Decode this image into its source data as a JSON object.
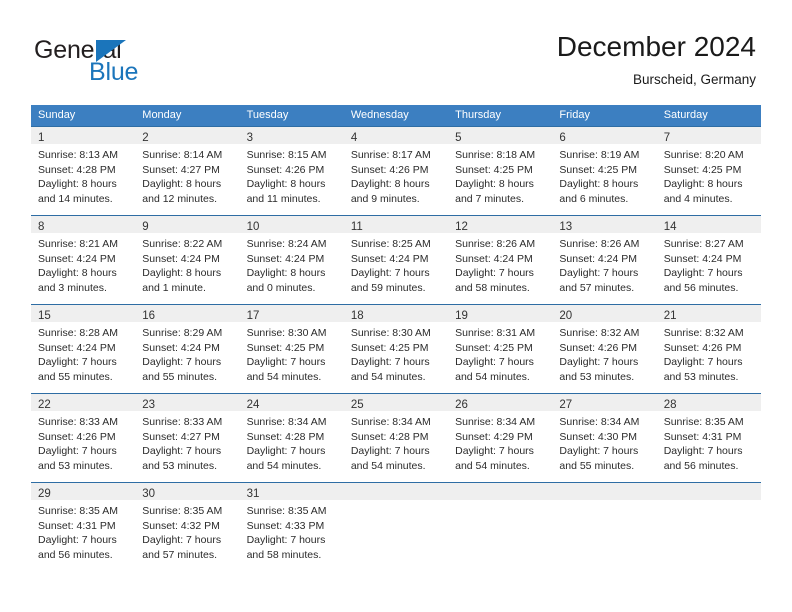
{
  "brand": {
    "logo_top": "General",
    "logo_bottom": "Blue",
    "accent_color": "#1b75bb"
  },
  "header": {
    "title": "December 2024",
    "subtitle": "Burscheid, Germany"
  },
  "theme": {
    "header_row_bg": "#3c7fc1",
    "row_divider": "#2e6da4",
    "daynum_band_bg": "#efefef"
  },
  "weekday_headers": [
    "Sunday",
    "Monday",
    "Tuesday",
    "Wednesday",
    "Thursday",
    "Friday",
    "Saturday"
  ],
  "weeks": [
    [
      {
        "day": "1",
        "sunrise": "Sunrise: 8:13 AM",
        "sunset": "Sunset: 4:28 PM",
        "daylight1": "Daylight: 8 hours",
        "daylight2": "and 14 minutes."
      },
      {
        "day": "2",
        "sunrise": "Sunrise: 8:14 AM",
        "sunset": "Sunset: 4:27 PM",
        "daylight1": "Daylight: 8 hours",
        "daylight2": "and 12 minutes."
      },
      {
        "day": "3",
        "sunrise": "Sunrise: 8:15 AM",
        "sunset": "Sunset: 4:26 PM",
        "daylight1": "Daylight: 8 hours",
        "daylight2": "and 11 minutes."
      },
      {
        "day": "4",
        "sunrise": "Sunrise: 8:17 AM",
        "sunset": "Sunset: 4:26 PM",
        "daylight1": "Daylight: 8 hours",
        "daylight2": "and 9 minutes."
      },
      {
        "day": "5",
        "sunrise": "Sunrise: 8:18 AM",
        "sunset": "Sunset: 4:25 PM",
        "daylight1": "Daylight: 8 hours",
        "daylight2": "and 7 minutes."
      },
      {
        "day": "6",
        "sunrise": "Sunrise: 8:19 AM",
        "sunset": "Sunset: 4:25 PM",
        "daylight1": "Daylight: 8 hours",
        "daylight2": "and 6 minutes."
      },
      {
        "day": "7",
        "sunrise": "Sunrise: 8:20 AM",
        "sunset": "Sunset: 4:25 PM",
        "daylight1": "Daylight: 8 hours",
        "daylight2": "and 4 minutes."
      }
    ],
    [
      {
        "day": "8",
        "sunrise": "Sunrise: 8:21 AM",
        "sunset": "Sunset: 4:24 PM",
        "daylight1": "Daylight: 8 hours",
        "daylight2": "and 3 minutes."
      },
      {
        "day": "9",
        "sunrise": "Sunrise: 8:22 AM",
        "sunset": "Sunset: 4:24 PM",
        "daylight1": "Daylight: 8 hours",
        "daylight2": "and 1 minute."
      },
      {
        "day": "10",
        "sunrise": "Sunrise: 8:24 AM",
        "sunset": "Sunset: 4:24 PM",
        "daylight1": "Daylight: 8 hours",
        "daylight2": "and 0 minutes."
      },
      {
        "day": "11",
        "sunrise": "Sunrise: 8:25 AM",
        "sunset": "Sunset: 4:24 PM",
        "daylight1": "Daylight: 7 hours",
        "daylight2": "and 59 minutes."
      },
      {
        "day": "12",
        "sunrise": "Sunrise: 8:26 AM",
        "sunset": "Sunset: 4:24 PM",
        "daylight1": "Daylight: 7 hours",
        "daylight2": "and 58 minutes."
      },
      {
        "day": "13",
        "sunrise": "Sunrise: 8:26 AM",
        "sunset": "Sunset: 4:24 PM",
        "daylight1": "Daylight: 7 hours",
        "daylight2": "and 57 minutes."
      },
      {
        "day": "14",
        "sunrise": "Sunrise: 8:27 AM",
        "sunset": "Sunset: 4:24 PM",
        "daylight1": "Daylight: 7 hours",
        "daylight2": "and 56 minutes."
      }
    ],
    [
      {
        "day": "15",
        "sunrise": "Sunrise: 8:28 AM",
        "sunset": "Sunset: 4:24 PM",
        "daylight1": "Daylight: 7 hours",
        "daylight2": "and 55 minutes."
      },
      {
        "day": "16",
        "sunrise": "Sunrise: 8:29 AM",
        "sunset": "Sunset: 4:24 PM",
        "daylight1": "Daylight: 7 hours",
        "daylight2": "and 55 minutes."
      },
      {
        "day": "17",
        "sunrise": "Sunrise: 8:30 AM",
        "sunset": "Sunset: 4:25 PM",
        "daylight1": "Daylight: 7 hours",
        "daylight2": "and 54 minutes."
      },
      {
        "day": "18",
        "sunrise": "Sunrise: 8:30 AM",
        "sunset": "Sunset: 4:25 PM",
        "daylight1": "Daylight: 7 hours",
        "daylight2": "and 54 minutes."
      },
      {
        "day": "19",
        "sunrise": "Sunrise: 8:31 AM",
        "sunset": "Sunset: 4:25 PM",
        "daylight1": "Daylight: 7 hours",
        "daylight2": "and 54 minutes."
      },
      {
        "day": "20",
        "sunrise": "Sunrise: 8:32 AM",
        "sunset": "Sunset: 4:26 PM",
        "daylight1": "Daylight: 7 hours",
        "daylight2": "and 53 minutes."
      },
      {
        "day": "21",
        "sunrise": "Sunrise: 8:32 AM",
        "sunset": "Sunset: 4:26 PM",
        "daylight1": "Daylight: 7 hours",
        "daylight2": "and 53 minutes."
      }
    ],
    [
      {
        "day": "22",
        "sunrise": "Sunrise: 8:33 AM",
        "sunset": "Sunset: 4:26 PM",
        "daylight1": "Daylight: 7 hours",
        "daylight2": "and 53 minutes."
      },
      {
        "day": "23",
        "sunrise": "Sunrise: 8:33 AM",
        "sunset": "Sunset: 4:27 PM",
        "daylight1": "Daylight: 7 hours",
        "daylight2": "and 53 minutes."
      },
      {
        "day": "24",
        "sunrise": "Sunrise: 8:34 AM",
        "sunset": "Sunset: 4:28 PM",
        "daylight1": "Daylight: 7 hours",
        "daylight2": "and 54 minutes."
      },
      {
        "day": "25",
        "sunrise": "Sunrise: 8:34 AM",
        "sunset": "Sunset: 4:28 PM",
        "daylight1": "Daylight: 7 hours",
        "daylight2": "and 54 minutes."
      },
      {
        "day": "26",
        "sunrise": "Sunrise: 8:34 AM",
        "sunset": "Sunset: 4:29 PM",
        "daylight1": "Daylight: 7 hours",
        "daylight2": "and 54 minutes."
      },
      {
        "day": "27",
        "sunrise": "Sunrise: 8:34 AM",
        "sunset": "Sunset: 4:30 PM",
        "daylight1": "Daylight: 7 hours",
        "daylight2": "and 55 minutes."
      },
      {
        "day": "28",
        "sunrise": "Sunrise: 8:35 AM",
        "sunset": "Sunset: 4:31 PM",
        "daylight1": "Daylight: 7 hours",
        "daylight2": "and 56 minutes."
      }
    ],
    [
      {
        "day": "29",
        "sunrise": "Sunrise: 8:35 AM",
        "sunset": "Sunset: 4:31 PM",
        "daylight1": "Daylight: 7 hours",
        "daylight2": "and 56 minutes."
      },
      {
        "day": "30",
        "sunrise": "Sunrise: 8:35 AM",
        "sunset": "Sunset: 4:32 PM",
        "daylight1": "Daylight: 7 hours",
        "daylight2": "and 57 minutes."
      },
      {
        "day": "31",
        "sunrise": "Sunrise: 8:35 AM",
        "sunset": "Sunset: 4:33 PM",
        "daylight1": "Daylight: 7 hours",
        "daylight2": "and 58 minutes."
      },
      {
        "day": "",
        "sunrise": "",
        "sunset": "",
        "daylight1": "",
        "daylight2": ""
      },
      {
        "day": "",
        "sunrise": "",
        "sunset": "",
        "daylight1": "",
        "daylight2": ""
      },
      {
        "day": "",
        "sunrise": "",
        "sunset": "",
        "daylight1": "",
        "daylight2": ""
      },
      {
        "day": "",
        "sunrise": "",
        "sunset": "",
        "daylight1": "",
        "daylight2": ""
      }
    ]
  ]
}
